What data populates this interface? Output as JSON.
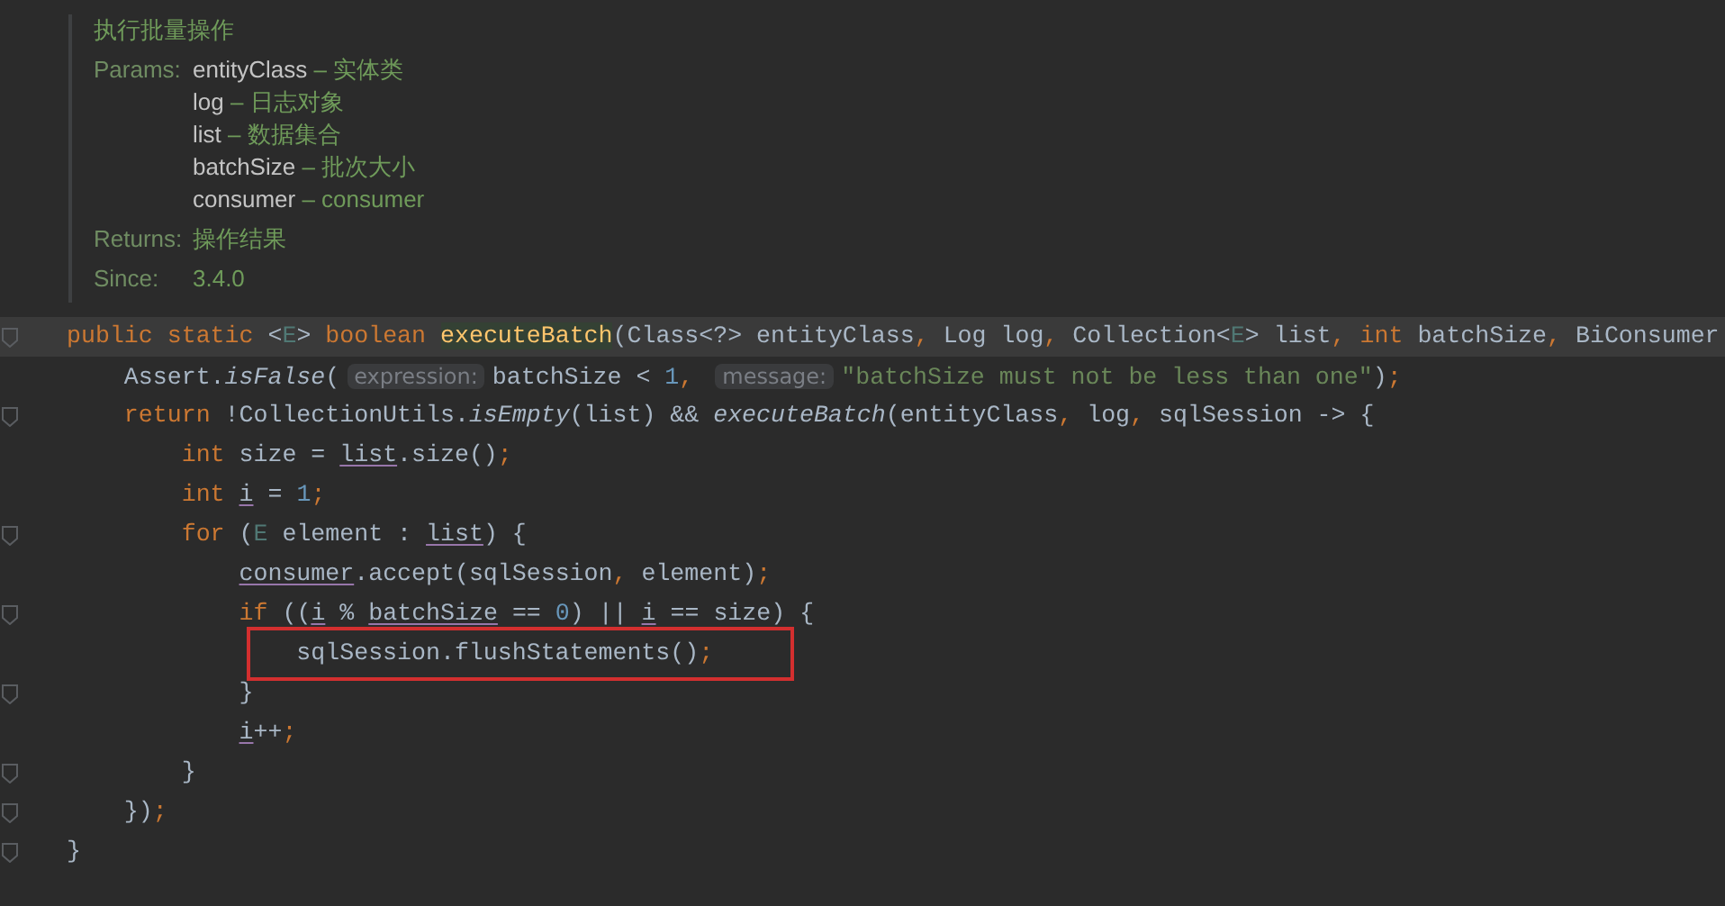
{
  "doc": {
    "summary": "执行批量操作",
    "params_label": "Params:",
    "params": [
      {
        "name": "entityClass",
        "desc": "– 实体类"
      },
      {
        "name": "log",
        "desc": "– 日志对象"
      },
      {
        "name": "list",
        "desc": "– 数据集合"
      },
      {
        "name": "batchSize",
        "desc": "– 批次大小"
      },
      {
        "name": "consumer",
        "desc": "– consumer"
      }
    ],
    "returns_label": "Returns:",
    "returns": "操作结果",
    "since_label": "Since:",
    "since": "3.4.0"
  },
  "code_lines": [
    {
      "fold": true,
      "current": true,
      "highlighted": false,
      "tokens": [
        {
          "kind": "kw",
          "text": "public static "
        },
        {
          "kind": "plain",
          "text": "<"
        },
        {
          "kind": "tp",
          "text": "E"
        },
        {
          "kind": "plain",
          "text": "> "
        },
        {
          "kind": "kw",
          "text": "boolean "
        },
        {
          "kind": "decl",
          "text": "executeBatch"
        },
        {
          "kind": "plain",
          "text": "(Class<?> entityClass"
        },
        {
          "kind": "punct",
          "text": ", "
        },
        {
          "kind": "plain",
          "text": "Log log"
        },
        {
          "kind": "punct",
          "text": ", "
        },
        {
          "kind": "plain",
          "text": "Collection<"
        },
        {
          "kind": "tp",
          "text": "E"
        },
        {
          "kind": "plain",
          "text": "> list"
        },
        {
          "kind": "punct",
          "text": ", "
        },
        {
          "kind": "kw",
          "text": "int "
        },
        {
          "kind": "plain",
          "text": "batchSize"
        },
        {
          "kind": "punct",
          "text": ", "
        },
        {
          "kind": "plain",
          "text": "BiConsumer"
        }
      ]
    },
    {
      "fold": false,
      "current": false,
      "highlighted": false,
      "tokens": [
        {
          "kind": "plain",
          "text": "    Assert."
        },
        {
          "kind": "static",
          "text": "isFalse"
        },
        {
          "kind": "plain",
          "text": "("
        },
        {
          "kind": "hint",
          "text": "expression:"
        },
        {
          "kind": "plain",
          "text": "batchSize < "
        },
        {
          "kind": "num",
          "text": "1"
        },
        {
          "kind": "punct",
          "text": ", "
        },
        {
          "kind": "hint",
          "text": "message:"
        },
        {
          "kind": "str",
          "text": "\"batchSize must not be less than one\""
        },
        {
          "kind": "plain",
          "text": ")"
        },
        {
          "kind": "punct",
          "text": ";"
        }
      ]
    },
    {
      "fold": true,
      "current": false,
      "highlighted": false,
      "tokens": [
        {
          "kind": "kw",
          "text": "    return "
        },
        {
          "kind": "plain",
          "text": "!CollectionUtils."
        },
        {
          "kind": "static",
          "text": "isEmpty"
        },
        {
          "kind": "plain",
          "text": "(list) && "
        },
        {
          "kind": "static",
          "text": "executeBatch"
        },
        {
          "kind": "plain",
          "text": "(entityClass"
        },
        {
          "kind": "punct",
          "text": ", "
        },
        {
          "kind": "plain",
          "text": "log"
        },
        {
          "kind": "punct",
          "text": ", "
        },
        {
          "kind": "plain",
          "text": "sqlSession -> {"
        }
      ]
    },
    {
      "fold": false,
      "current": false,
      "highlighted": false,
      "tokens": [
        {
          "kind": "kw",
          "text": "        int "
        },
        {
          "kind": "plain",
          "text": "size = "
        },
        {
          "kind": "ref",
          "text": "list"
        },
        {
          "kind": "plain",
          "text": ".size()"
        },
        {
          "kind": "punct",
          "text": ";"
        }
      ]
    },
    {
      "fold": false,
      "current": false,
      "highlighted": false,
      "tokens": [
        {
          "kind": "kw",
          "text": "        int "
        },
        {
          "kind": "ref",
          "text": "i"
        },
        {
          "kind": "plain",
          "text": " = "
        },
        {
          "kind": "num",
          "text": "1"
        },
        {
          "kind": "punct",
          "text": ";"
        }
      ]
    },
    {
      "fold": true,
      "current": false,
      "highlighted": false,
      "tokens": [
        {
          "kind": "kw",
          "text": "        for "
        },
        {
          "kind": "plain",
          "text": "("
        },
        {
          "kind": "tp",
          "text": "E"
        },
        {
          "kind": "plain",
          "text": " element : "
        },
        {
          "kind": "ref",
          "text": "list"
        },
        {
          "kind": "plain",
          "text": ") {"
        }
      ]
    },
    {
      "fold": false,
      "current": false,
      "highlighted": false,
      "tokens": [
        {
          "kind": "ref",
          "text": "            consumer"
        },
        {
          "kind": "plain",
          "text": ".accept(sqlSession"
        },
        {
          "kind": "punct",
          "text": ", "
        },
        {
          "kind": "plain",
          "text": "element)"
        },
        {
          "kind": "punct",
          "text": ";"
        }
      ]
    },
    {
      "fold": true,
      "current": false,
      "highlighted": false,
      "tokens": [
        {
          "kind": "kw",
          "text": "            if "
        },
        {
          "kind": "plain",
          "text": "(("
        },
        {
          "kind": "ref",
          "text": "i"
        },
        {
          "kind": "plain",
          "text": " % "
        },
        {
          "kind": "ref",
          "text": "batchSize"
        },
        {
          "kind": "plain",
          "text": " == "
        },
        {
          "kind": "num",
          "text": "0"
        },
        {
          "kind": "plain",
          "text": ") || "
        },
        {
          "kind": "ref",
          "text": "i"
        },
        {
          "kind": "plain",
          "text": " == size) {"
        }
      ]
    },
    {
      "fold": false,
      "current": false,
      "highlighted": true,
      "tokens": [
        {
          "kind": "plain",
          "text": "                sqlSession.flushStatements()"
        },
        {
          "kind": "punct",
          "text": ";"
        }
      ]
    },
    {
      "fold": true,
      "current": false,
      "highlighted": false,
      "tokens": [
        {
          "kind": "plain",
          "text": "            }"
        }
      ]
    },
    {
      "fold": false,
      "current": false,
      "highlighted": false,
      "tokens": [
        {
          "kind": "ref",
          "text": "            i"
        },
        {
          "kind": "plain",
          "text": "++"
        },
        {
          "kind": "punct",
          "text": ";"
        }
      ]
    },
    {
      "fold": true,
      "current": false,
      "highlighted": false,
      "tokens": [
        {
          "kind": "plain",
          "text": "        }"
        }
      ]
    },
    {
      "fold": true,
      "current": false,
      "highlighted": false,
      "tokens": [
        {
          "kind": "plain",
          "text": "    })"
        },
        {
          "kind": "punct",
          "text": ";"
        }
      ]
    },
    {
      "fold": true,
      "current": false,
      "highlighted": false,
      "tokens": [
        {
          "kind": "plain",
          "text": "}"
        }
      ]
    }
  ]
}
